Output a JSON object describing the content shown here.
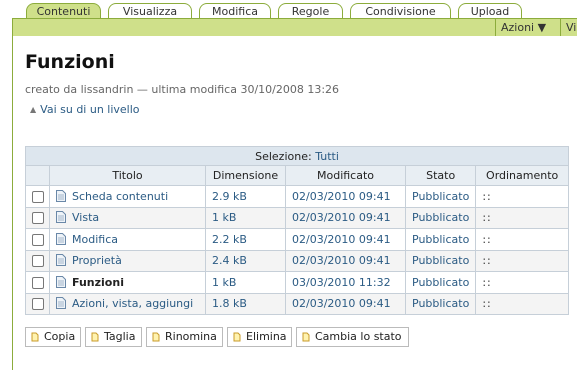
{
  "tabs": [
    "Contenuti",
    "Visualizza",
    "Modifica",
    "Regole",
    "Condivisione",
    "Upload"
  ],
  "actions_menu": "Azioni ▼",
  "view_menu_partial": "Vis",
  "page": {
    "title": "Funzioni",
    "byline": "creato da lissandrin — ultima modifica 30/10/2008 13:26",
    "up_level": "Vai su di un livello"
  },
  "table": {
    "selection_label": "Selezione:",
    "selection_link": "Tutti",
    "columns": [
      "Titolo",
      "Dimensione",
      "Modificato",
      "Stato",
      "Ordinamento"
    ],
    "rows": [
      {
        "title": "Scheda contenuti",
        "size": "2.9 kB",
        "modified": "02/03/2010 09:41",
        "state": "Pubblicato",
        "order": "::"
      },
      {
        "title": "Vista",
        "size": "1 kB",
        "modified": "02/03/2010 09:41",
        "state": "Pubblicato",
        "order": "::"
      },
      {
        "title": "Modifica",
        "size": "2.2 kB",
        "modified": "02/03/2010 09:41",
        "state": "Pubblicato",
        "order": "::"
      },
      {
        "title": "Proprietà",
        "size": "2.4 kB",
        "modified": "02/03/2010 09:41",
        "state": "Pubblicato",
        "order": "::"
      },
      {
        "title": "Funzioni",
        "size": "1 kB",
        "modified": "03/03/2010 11:32",
        "state": "Pubblicato",
        "order": "::"
      },
      {
        "title": "Azioni, vista, aggiungi",
        "size": "1.8 kB",
        "modified": "02/03/2010 09:41",
        "state": "Pubblicato",
        "order": "::"
      }
    ]
  },
  "buttons": [
    "Copia",
    "Taglia",
    "Rinomina",
    "Elimina",
    "Cambia lo stato"
  ],
  "colors": {
    "tab_active": "#cfe08a",
    "tab_border": "#8cac3c",
    "link": "#2b5b84"
  }
}
